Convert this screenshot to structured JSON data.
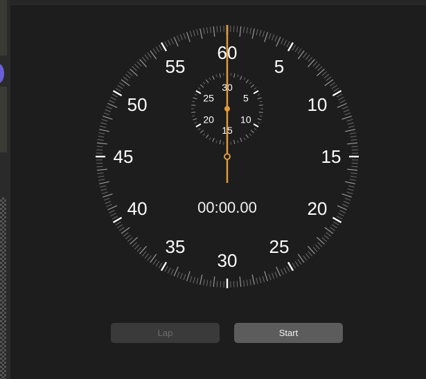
{
  "stopwatch": {
    "elapsed_time": "00:00.00",
    "main_dial_labels": [
      "60",
      "5",
      "10",
      "15",
      "20",
      "25",
      "30",
      "35",
      "40",
      "45",
      "50",
      "55"
    ],
    "sub_dial_labels": [
      "30",
      "5",
      "10",
      "15",
      "20",
      "25"
    ],
    "hand_color": "#e39b3c",
    "dial_color": "#ffffff"
  },
  "controls": {
    "lap_label": "Lap",
    "start_label": "Start"
  }
}
